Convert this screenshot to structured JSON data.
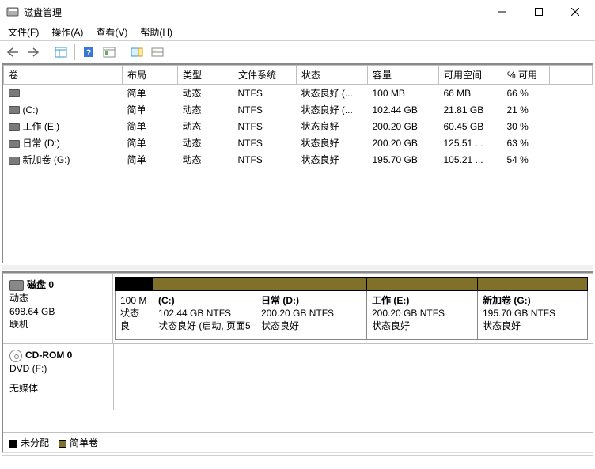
{
  "window": {
    "title": "磁盘管理"
  },
  "menu": {
    "file": "文件(F)",
    "action": "操作(A)",
    "view": "查看(V)",
    "help": "帮助(H)"
  },
  "columns": {
    "vol": "卷",
    "layout": "布局",
    "type": "类型",
    "fs": "文件系统",
    "status": "状态",
    "capacity": "容量",
    "free": "可用空间",
    "pct": "% 可用"
  },
  "volumes": [
    {
      "name": "",
      "layout": "简单",
      "type": "动态",
      "fs": "NTFS",
      "status": "状态良好 (...",
      "capacity": "100 MB",
      "free": "66 MB",
      "pct": "66 %"
    },
    {
      "name": "(C:)",
      "layout": "简单",
      "type": "动态",
      "fs": "NTFS",
      "status": "状态良好 (...",
      "capacity": "102.44 GB",
      "free": "21.81 GB",
      "pct": "21 %"
    },
    {
      "name": "工作 (E:)",
      "layout": "简单",
      "type": "动态",
      "fs": "NTFS",
      "status": "状态良好",
      "capacity": "200.20 GB",
      "free": "60.45 GB",
      "pct": "30 %"
    },
    {
      "name": "日常 (D:)",
      "layout": "简单",
      "type": "动态",
      "fs": "NTFS",
      "status": "状态良好",
      "capacity": "200.20 GB",
      "free": "125.51 ...",
      "pct": "63 %"
    },
    {
      "name": "新加卷 (G:)",
      "layout": "简单",
      "type": "动态",
      "fs": "NTFS",
      "status": "状态良好",
      "capacity": "195.70 GB",
      "free": "105.21 ...",
      "pct": "54 %"
    }
  ],
  "disk0": {
    "title": "磁盘 0",
    "type": "动态",
    "size": "698.64 GB",
    "state": "联机",
    "parts": [
      {
        "label": "",
        "line2": "100 M",
        "line3": "状态良",
        "w": 48
      },
      {
        "label": "(C:)",
        "line2": "102.44 GB NTFS",
        "line3": "状态良好 (启动, 页面5",
        "w": 130
      },
      {
        "label": "日常  (D:)",
        "line2": "200.20 GB NTFS",
        "line3": "状态良好",
        "w": 140
      },
      {
        "label": "工作  (E:)",
        "line2": "200.20 GB NTFS",
        "line3": "状态良好",
        "w": 140
      },
      {
        "label": "新加卷  (G:)",
        "line2": "195.70 GB NTFS",
        "line3": "状态良好",
        "w": 140
      }
    ]
  },
  "cdrom": {
    "title": "CD-ROM 0",
    "sub": "DVD (F:)",
    "state": "无媒体"
  },
  "legend": {
    "unalloc": "未分配",
    "simple": "简单卷"
  }
}
